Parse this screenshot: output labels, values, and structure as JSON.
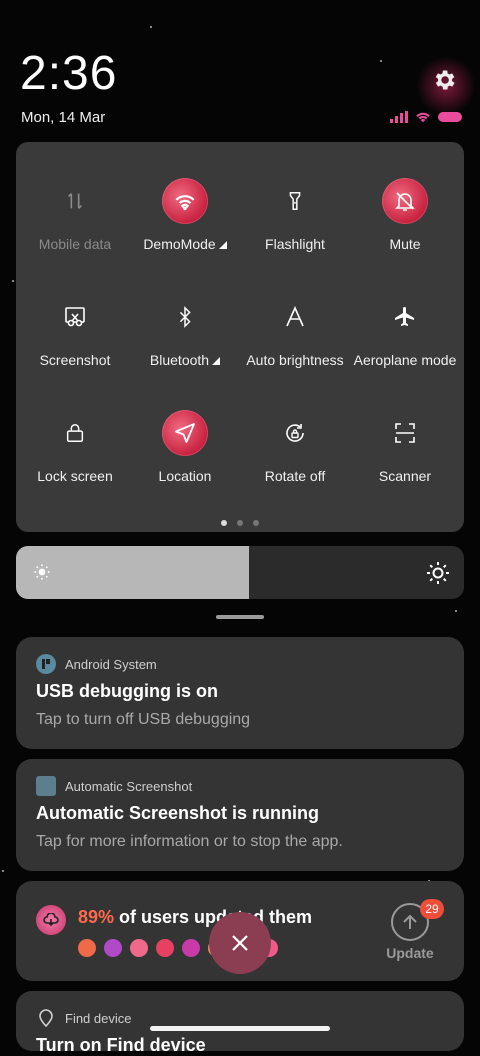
{
  "status": {
    "time": "2:36",
    "date": "Mon, 14 Mar"
  },
  "colors": {
    "accent_active": "#d8304a",
    "panel_bg": "#3a3a3a",
    "battery": "#e94c9a",
    "promo_highlight": "#ff6a4d",
    "badge": "#ee4d3a"
  },
  "quick_settings": {
    "tiles": [
      {
        "label": "Mobile data",
        "icon": "mobile-data-icon",
        "active": false,
        "disabled": true
      },
      {
        "label": "DemoMode",
        "icon": "wifi-icon",
        "active": true,
        "disabled": false,
        "expandable": true
      },
      {
        "label": "Flashlight",
        "icon": "flashlight-icon",
        "active": false,
        "disabled": false
      },
      {
        "label": "Mute",
        "icon": "bell-off-icon",
        "active": true,
        "disabled": false
      },
      {
        "label": "Screenshot",
        "icon": "scissors-icon",
        "active": false,
        "disabled": false
      },
      {
        "label": "Bluetooth",
        "icon": "bluetooth-icon",
        "active": false,
        "disabled": false,
        "expandable": true
      },
      {
        "label": "Auto brightness",
        "icon": "auto-brightness-icon",
        "active": false,
        "disabled": false
      },
      {
        "label": "Aeroplane mode",
        "icon": "airplane-icon",
        "active": false,
        "disabled": false
      },
      {
        "label": "Lock screen",
        "icon": "lock-icon",
        "active": false,
        "disabled": false
      },
      {
        "label": "Location",
        "icon": "location-arrow-icon",
        "active": true,
        "disabled": false
      },
      {
        "label": "Rotate off",
        "icon": "rotate-lock-icon",
        "active": false,
        "disabled": false
      },
      {
        "label": "Scanner",
        "icon": "scanner-icon",
        "active": false,
        "disabled": false
      }
    ],
    "page_count": 3,
    "current_page": 1
  },
  "brightness": {
    "level": 0.52
  },
  "notifications": [
    {
      "app": "Android System",
      "title": "USB debugging is on",
      "body": "Tap to turn off USB debugging"
    },
    {
      "app": "Automatic Screenshot",
      "title": "Automatic Screenshot is running",
      "body": "Tap for more information or to stop the app."
    },
    {
      "promo_percent": "89%",
      "promo_text": " of users updated them",
      "update_label": "Update",
      "badge_count": "29"
    },
    {
      "app": "Find device",
      "title": "Turn on Find device"
    }
  ]
}
